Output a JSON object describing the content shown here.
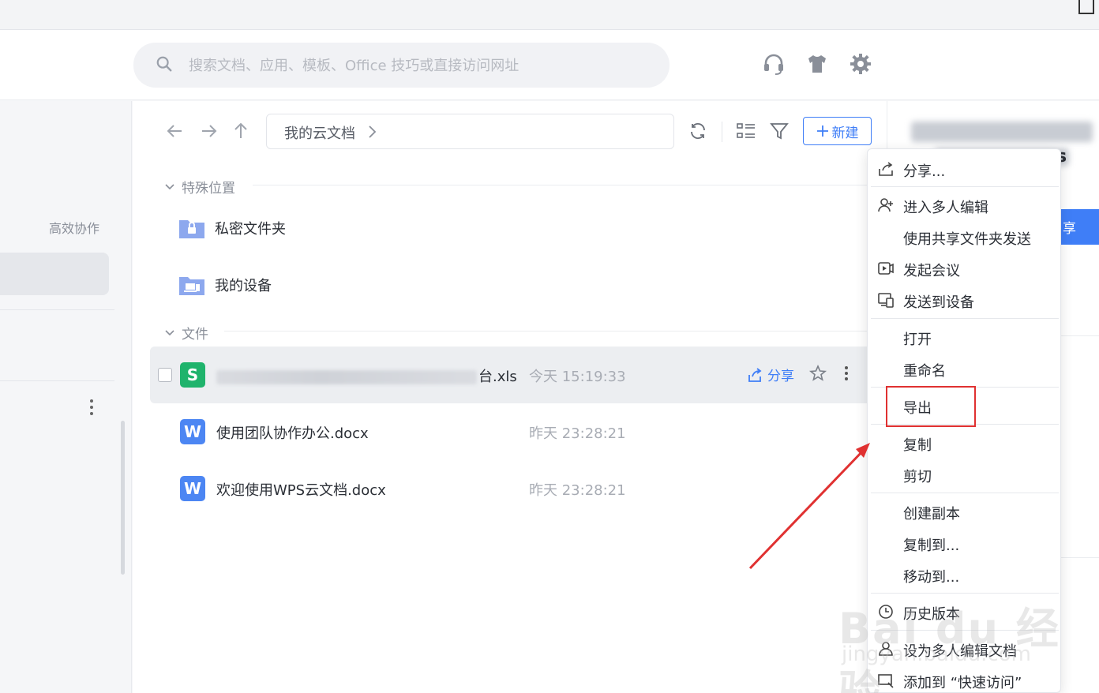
{
  "search": {
    "placeholder": "搜索文档、应用、模板、Office 技巧或直接访问网址"
  },
  "left_nav": {
    "collab_label": "高效协作"
  },
  "toolbar": {
    "breadcrumb": "我的云文档",
    "new_label": "新建"
  },
  "sections": {
    "special": "特殊位置",
    "files": "文件"
  },
  "folders": [
    {
      "name": "私密文件夹"
    },
    {
      "name": "我的设备"
    }
  ],
  "files": [
    {
      "name_suffix": "台.xls",
      "time": "今天 15:19:33",
      "type": "S",
      "share": "分享"
    },
    {
      "name": "使用团队协作办公.docx",
      "time": "昨天 23:28:21",
      "type": "W"
    },
    {
      "name": "欢迎使用WPS云文档.docx",
      "time": "昨天 23:28:21",
      "type": "W"
    }
  ],
  "right_panel": {
    "title_tail": "s",
    "button_tail": "享"
  },
  "context_menu": {
    "share": "分享...",
    "multi_edit": "进入多人编辑",
    "shared_folder_send": "使用共享文件夹发送",
    "meeting": "发起会议",
    "send_device": "发送到设备",
    "open": "打开",
    "rename": "重命名",
    "export": "导出",
    "copy": "复制",
    "cut": "剪切",
    "duplicate": "创建副本",
    "copy_to": "复制到...",
    "move_to": "移动到...",
    "history": "历史版本",
    "set_multi": "设为多人编辑文档",
    "quick_access": "添加到 “快速访问”"
  },
  "watermark": {
    "main": "Bai du 经验",
    "sub": "jingyan.baidu.com"
  },
  "colors": {
    "accent": "#3f7ef7",
    "xls": "#1fb36c",
    "doc": "#4c86f3",
    "highlight": "#e03131"
  }
}
